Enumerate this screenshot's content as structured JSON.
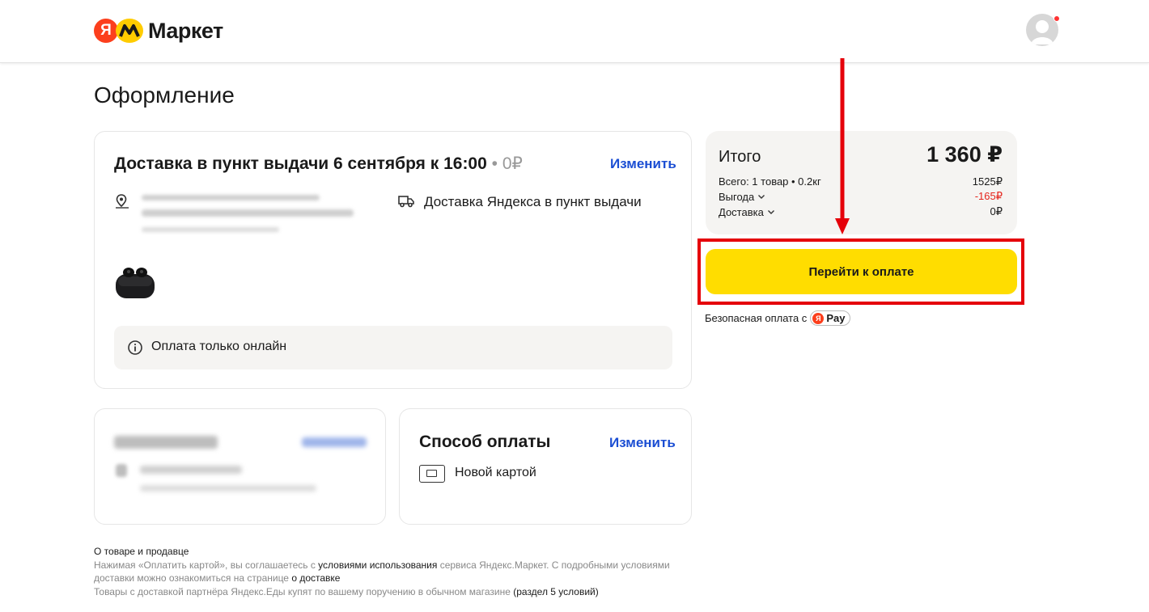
{
  "header": {
    "logo_ya": "Я",
    "logo_text": "Маркет"
  },
  "page": {
    "title": "Оформление"
  },
  "delivery": {
    "title": "Доставка в пункт выдачи 6 сентября к 16:00",
    "separator": "•",
    "cost": "0₽",
    "change_label": "Изменить",
    "method": "Доставка Яндекса в пункт выдачи",
    "notice": "Оплата только онлайн"
  },
  "payment": {
    "title": "Способ оплаты",
    "change_label": "Изменить",
    "method": "Новой картой"
  },
  "summary": {
    "title": "Итого",
    "total": "1 360 ₽",
    "rows": [
      {
        "label": "Всего: 1 товар • 0.2кг",
        "value": "1525₽"
      },
      {
        "label": "Выгода",
        "value": "-165₽"
      },
      {
        "label": "Доставка",
        "value": "0₽"
      }
    ]
  },
  "checkout": {
    "button_label": "Перейти к оплате",
    "safe_pay_text": "Безопасная оплата с",
    "pay_badge_ya": "Я",
    "pay_badge_text": "Pay"
  },
  "footer": {
    "line1": "О товаре и продавце",
    "line2_a": "Нажимая «Оплатить картой», вы соглашаетесь с ",
    "line2_link": "условиями использования",
    "line2_b": " сервиса Яндекс.Маркет. С подробными условиями доставки можно ознакомиться на странице ",
    "line2_link2": "о доставке",
    "line3_a": "Товары с доставкой партнёра Яндекс.Еды купят по вашему поручению в обычном магазине ",
    "line3_b": "(раздел 5 условий)"
  },
  "colors": {
    "accent_yellow": "#ffdd00",
    "link_blue": "#1b4ed3",
    "highlight_red": "#e5000a",
    "brand_red": "#fc3f1d"
  },
  "icons": [
    "location-pin-icon",
    "truck-icon",
    "info-icon",
    "card-icon",
    "chevron-down-icon",
    "avatar-icon",
    "arrow-down-annotation"
  ]
}
